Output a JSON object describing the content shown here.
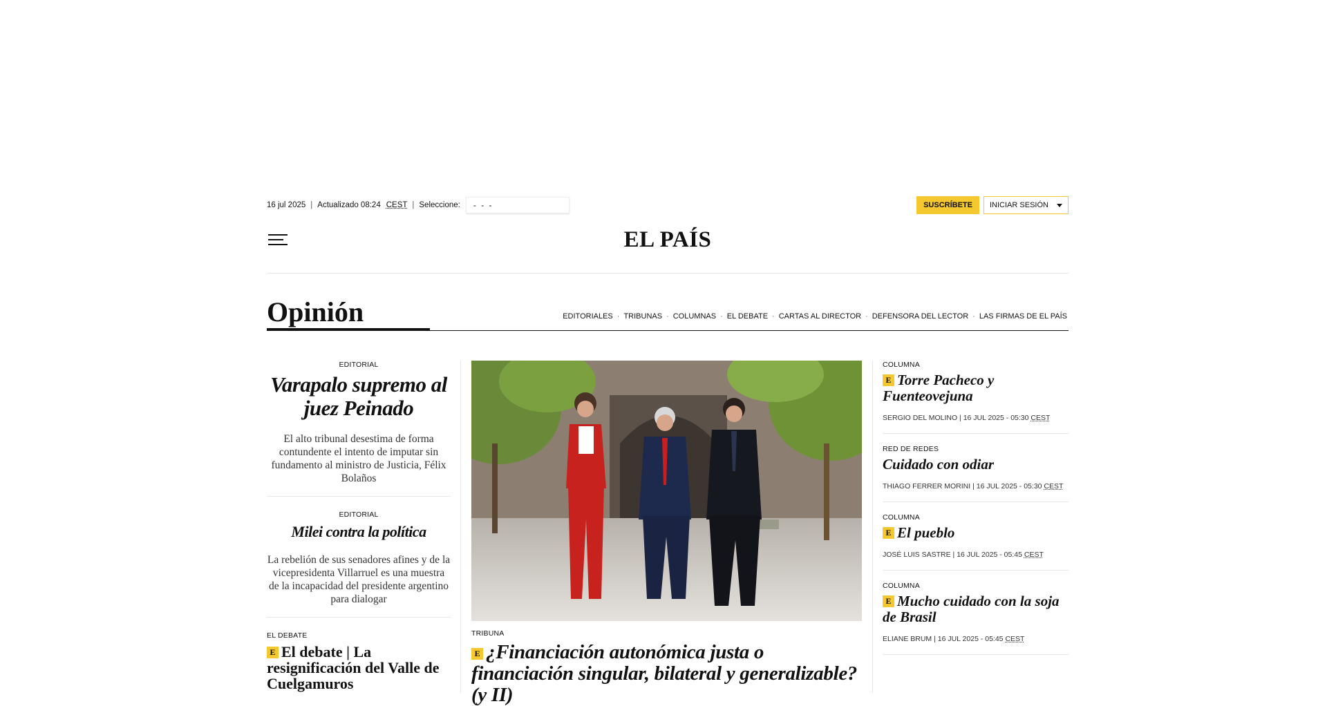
{
  "topbar": {
    "date": "16 jul 2025",
    "updated": "Actualizado 08:24",
    "timezone": "CEST",
    "select_label": "Seleccione:",
    "edition_value": "- - -",
    "subscribe_label": "SUSCRÍBETE",
    "login_label": "INICIAR SESIÓN"
  },
  "masthead": {
    "logo": "EL PAÍS"
  },
  "section": {
    "title": "Opinión",
    "nav": [
      "EDITORIALES",
      "TRIBUNAS",
      "COLUMNAS",
      "EL DEBATE",
      "CARTAS AL DIRECTOR",
      "DEFENSORA DEL LECTOR",
      "LAS FIRMAS DE EL PAÍS"
    ]
  },
  "left": {
    "items": [
      {
        "kicker": "EDITORIAL",
        "title": "Varapalo supremo al juez Peinado",
        "summary": "El alto tribunal desestima de forma contundente el intento de imputar sin fundamento al ministro de Justicia, Félix Bolaños"
      },
      {
        "kicker": "EDITORIAL",
        "title": "Milei contra la política",
        "summary": "La rebelión de sus senadores afines y de la vicepresidenta Villarruel es una muestra de la incapacidad del presidente argentino para dialogar"
      }
    ],
    "debate": {
      "kicker": "EL DEBATE",
      "badge": "E",
      "title": "El debate | La resignificación del Valle de Cuelgamuros"
    }
  },
  "middle": {
    "kicker": "TRIBUNA",
    "badge": "E",
    "title": "¿Financiación autonómica justa o financiación singular, bilateral y generalizable? (y II)"
  },
  "right": {
    "items": [
      {
        "kicker": "COLUMNA",
        "premium": true,
        "badge": "E",
        "title": "Torre Pacheco y Fuenteovejuna",
        "author": "SERGIO DEL MOLINO",
        "date": "16 JUL 2025 - 05:30",
        "tz": "CEST"
      },
      {
        "kicker": "RED DE REDES",
        "premium": false,
        "badge": "",
        "title": "Cuidado con odiar",
        "author": "THIAGO FERRER MORINI",
        "date": "16 JUL 2025 - 05:30",
        "tz": "CEST"
      },
      {
        "kicker": "COLUMNA",
        "premium": true,
        "badge": "E",
        "title": "El pueblo",
        "author": "JOSÉ LUIS SASTRE",
        "date": "16 JUL 2025 - 05:45",
        "tz": "CEST"
      },
      {
        "kicker": "COLUMNA",
        "premium": true,
        "badge": "E",
        "title": "Mucho cuidado con la soja de Brasil",
        "author": "ELIANE BRUM",
        "date": "16 JUL 2025 - 05:45",
        "tz": "CEST"
      }
    ]
  },
  "colors": {
    "accent_yellow": "#f4c82e",
    "rule": "#e6e6e6"
  },
  "icons": {
    "menu": "hamburger-icon",
    "dropdown": "caret-down-icon"
  }
}
